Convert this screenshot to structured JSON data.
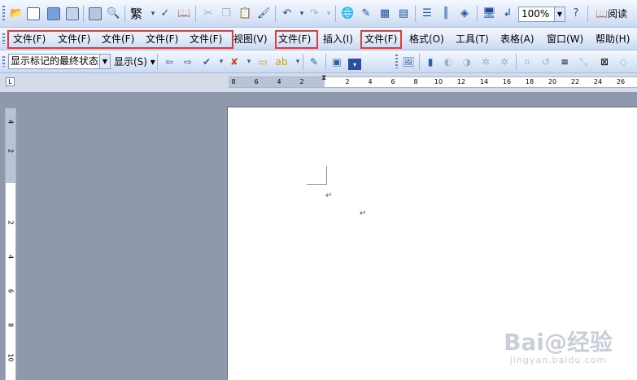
{
  "toolbar1": {
    "fan_label": "繁",
    "zoom_value": "100%",
    "read_label": "阅读"
  },
  "menus": {
    "wenjian_1": "文件(F)",
    "wenjian_2": "文件(F)",
    "wenjian_3": "文件(F)",
    "wenjian_4": "文件(F)",
    "wenjian_5": "文件(F)",
    "view": "视图(V)",
    "wenjian_6": "文件(F)",
    "insert": "插入(I)",
    "wenjian_7": "文件(F)",
    "format": "格式(O)",
    "tools": "工具(T)",
    "table": "表格(A)",
    "window": "窗口(W)",
    "help": "帮助(H)"
  },
  "toolbar2": {
    "markup_combo": "显示标记的最终状态",
    "show_label": "显示(S)"
  },
  "ruler_h": [
    "8",
    "6",
    "4",
    "2",
    "2",
    "4",
    "6",
    "8",
    "10",
    "12",
    "14",
    "16",
    "18",
    "20",
    "22",
    "24",
    "26"
  ],
  "ruler_v": [
    "4",
    "2",
    "2",
    "4",
    "6",
    "8",
    "10"
  ],
  "document": {
    "para_mark_1": "↵",
    "para_mark_2": "↵"
  },
  "watermark": {
    "logo": "Bai@经验",
    "url": "jingyan.baidu.com"
  },
  "colors": {
    "highlight": "#e23a3a",
    "toolbar": "#dde8f8",
    "workspace": "#8f98ad"
  }
}
